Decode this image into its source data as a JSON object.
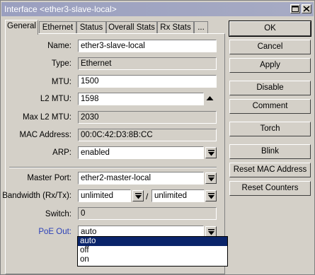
{
  "window": {
    "title": "Interface <ether3-slave-local>"
  },
  "tabs": [
    {
      "label": "General"
    },
    {
      "label": "Ethernet"
    },
    {
      "label": "Status"
    },
    {
      "label": "Overall Stats"
    },
    {
      "label": "Rx Stats"
    },
    {
      "label": "..."
    }
  ],
  "form": {
    "name": {
      "label": "Name:",
      "value": "ether3-slave-local"
    },
    "type": {
      "label": "Type:",
      "value": "Ethernet"
    },
    "mtu": {
      "label": "MTU:",
      "value": "1500"
    },
    "l2mtu": {
      "label": "L2 MTU:",
      "value": "1598"
    },
    "max_l2mtu": {
      "label": "Max L2 MTU:",
      "value": "2030"
    },
    "mac": {
      "label": "MAC Address:",
      "value": "00:0C:42:D3:8B:CC"
    },
    "arp": {
      "label": "ARP:",
      "value": "enabled"
    },
    "master_port": {
      "label": "Master Port:",
      "value": "ether2-master-local"
    },
    "bandwidth": {
      "label": "Bandwidth (Rx/Tx):",
      "rx": "unlimited",
      "sep": "/",
      "tx": "unlimited"
    },
    "switch": {
      "label": "Switch:",
      "value": "0"
    },
    "poe_out": {
      "label": "PoE Out:",
      "value": "auto",
      "options": [
        "auto",
        "off",
        "on"
      ],
      "label_color": "#2a3fb8"
    }
  },
  "buttons": {
    "ok": "OK",
    "cancel": "Cancel",
    "apply": "Apply",
    "disable": "Disable",
    "comment": "Comment",
    "torch": "Torch",
    "blink": "Blink",
    "reset_mac": "Reset MAC Address",
    "reset_counters": "Reset Counters"
  }
}
